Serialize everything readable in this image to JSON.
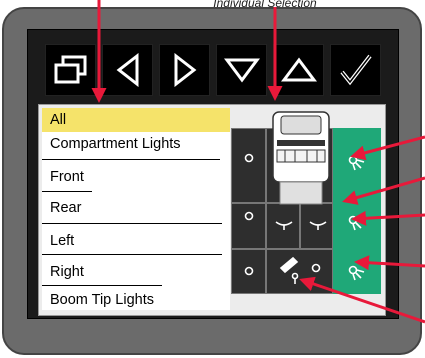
{
  "caption": "Individual Selection",
  "toolbar": {
    "buttons": [
      {
        "name": "window-toggle",
        "icon": "windows-icon"
      },
      {
        "name": "left",
        "icon": "triangle-left-icon"
      },
      {
        "name": "right",
        "icon": "triangle-right-icon"
      },
      {
        "name": "down",
        "icon": "triangle-down-icon"
      },
      {
        "name": "up",
        "icon": "triangle-up-icon"
      },
      {
        "name": "confirm",
        "icon": "checkmark-icon"
      }
    ]
  },
  "menu": {
    "items": [
      {
        "label": "All",
        "selected": true
      },
      {
        "label": "Compartment Lights",
        "selected": false
      },
      {
        "label": "Front",
        "selected": false
      },
      {
        "label": "Rear",
        "selected": false
      },
      {
        "label": "Left",
        "selected": false
      },
      {
        "label": "Right",
        "selected": false
      },
      {
        "label": "Boom Tip Lights",
        "selected": false
      }
    ]
  },
  "colors": {
    "selected": "#f5e36a",
    "active_cell": "#1fa878",
    "inactive_cell": "#2e2e2e",
    "callout": "#e8193a"
  },
  "light_map": {
    "icons": [
      "light-off-icon",
      "light-on-icon",
      "light-beam-icon",
      "boom-tip-icon",
      "truck-icon"
    ]
  }
}
